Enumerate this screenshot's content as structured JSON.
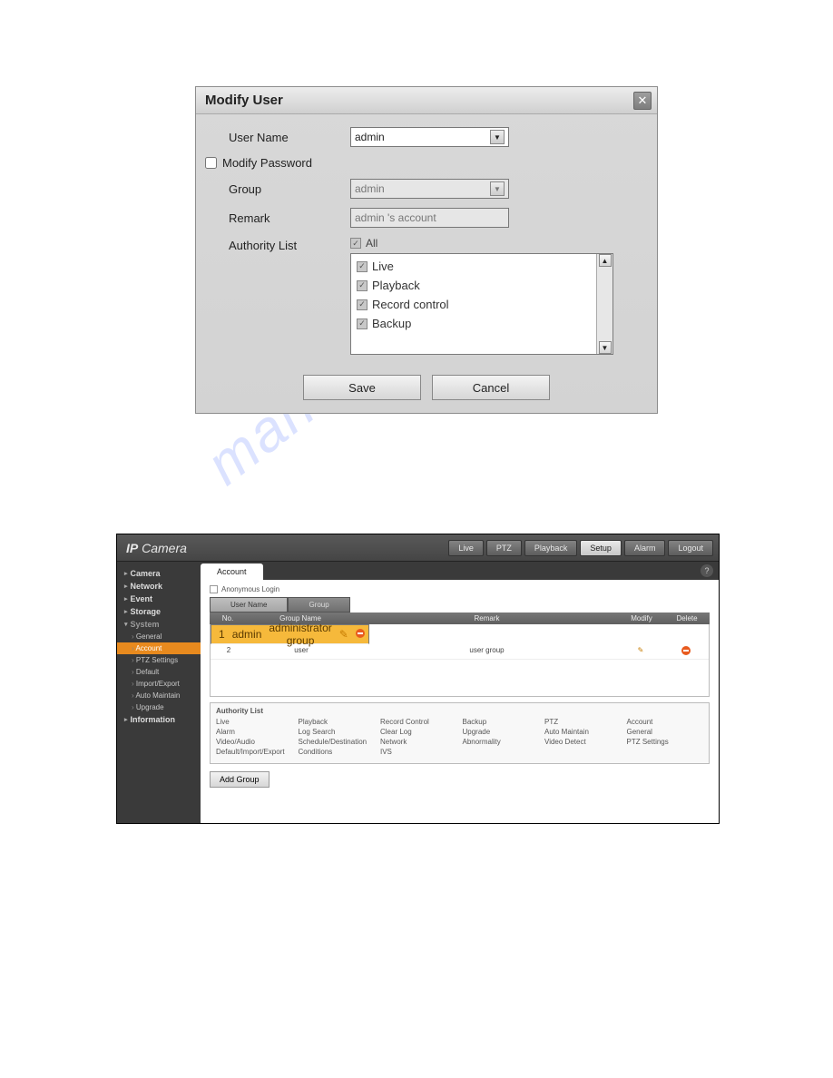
{
  "dialog": {
    "title": "Modify User",
    "labels": {
      "username": "User Name",
      "modify_pw": "Modify Password",
      "group": "Group",
      "remark": "Remark",
      "authority": "Authority List",
      "all": "All"
    },
    "values": {
      "username": "admin",
      "group": "admin",
      "remark": "admin 's account"
    },
    "authority_items": [
      "Live",
      "Playback",
      "Record control",
      "Backup"
    ],
    "buttons": {
      "save": "Save",
      "cancel": "Cancel"
    }
  },
  "app": {
    "brand_prefix": "IP",
    "brand_rest": " Camera",
    "topnav": [
      "Live",
      "PTZ",
      "Playback",
      "Setup",
      "Alarm",
      "Logout"
    ],
    "topnav_active": 3,
    "sidebar": {
      "top": [
        "Camera",
        "Network",
        "Event",
        "Storage"
      ],
      "system_label": "System",
      "system_children": [
        "General",
        "Account",
        "PTZ Settings",
        "Default",
        "Import/Export",
        "Auto Maintain",
        "Upgrade"
      ],
      "system_active": 1,
      "info": "Information"
    },
    "tab": "Account",
    "anon_label": "Anonymous Login",
    "subtabs": {
      "left": "User Name",
      "right": "Group"
    },
    "table": {
      "headers": {
        "no": "No.",
        "group": "Group Name",
        "remark": "Remark",
        "modify": "Modify",
        "delete": "Delete"
      },
      "rows": [
        {
          "no": "1",
          "group": "admin",
          "remark": "administrator group"
        },
        {
          "no": "2",
          "group": "user",
          "remark": "user group"
        }
      ]
    },
    "authlist": {
      "title": "Authority List",
      "items": [
        "Live",
        "Playback",
        "Record Control",
        "Backup",
        "PTZ",
        "Account",
        "Alarm",
        "Log Search",
        "Clear Log",
        "Upgrade",
        "Auto Maintain",
        "General",
        "Video/Audio",
        "Schedule/Destination",
        "Network",
        "Abnormality",
        "Video Detect",
        "PTZ Settings",
        "Default/Import/Export",
        "Conditions",
        "IVS"
      ]
    },
    "add_group": "Add Group"
  },
  "watermark": "manualshive.com"
}
